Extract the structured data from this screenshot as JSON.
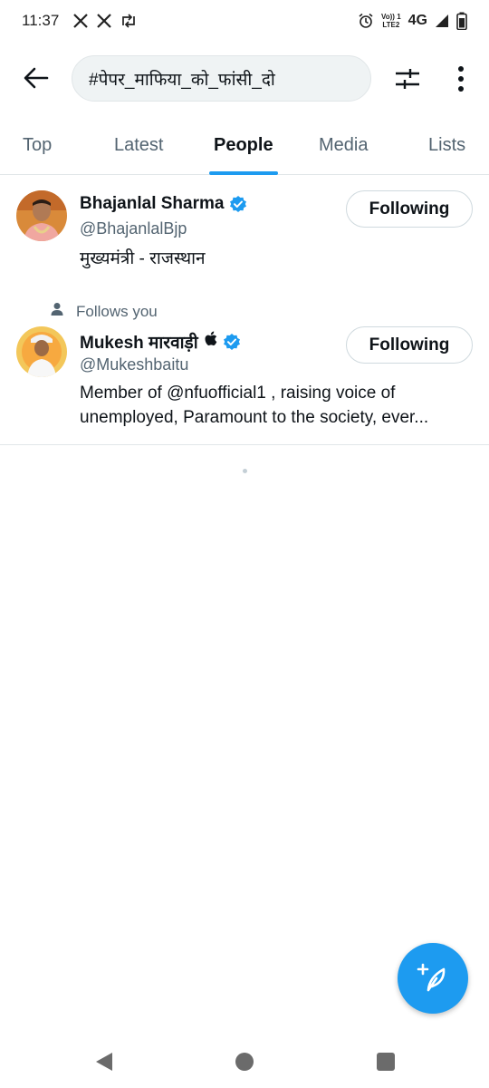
{
  "status_bar": {
    "time": "11:37",
    "volte_line1": "Vo)) 1",
    "volte_line2": "LTE2",
    "network": "4G",
    "notification_icons": [
      "x-logo-icon",
      "x-logo-icon",
      "repost-icon"
    ],
    "system_icons": [
      "alarm-icon",
      "signal-icon",
      "battery-icon"
    ]
  },
  "search": {
    "query": "#पेपर_माफिया_को_फांसी_दो"
  },
  "tabs": [
    {
      "label": "Top",
      "active": false
    },
    {
      "label": "Latest",
      "active": false
    },
    {
      "label": "People",
      "active": true
    },
    {
      "label": "Media",
      "active": false
    },
    {
      "label": "Lists",
      "active": false
    }
  ],
  "users": [
    {
      "name": "Bhajanlal Sharma",
      "handle": "@BhajanlalBjp",
      "bio": "मुख्यमंत्री - राजस्थान",
      "verified": true,
      "follow_label": "Following",
      "follows_you": ""
    },
    {
      "name": "Mukesh मारवाड़ी",
      "handle": "@Mukeshbaitu",
      "bio_line1": "Member of @nfuofficial1 , raising voice of",
      "bio_line2": "unemployed, Paramount to the society, ever...",
      "verified": true,
      "follow_label": "Following",
      "follows_you": "Follows you"
    }
  ],
  "colors": {
    "accent": "#1d9bf0",
    "text_primary": "#0f1419",
    "text_secondary": "#536471",
    "divider": "#e1e6e8"
  },
  "icons": {
    "back": "arrow-left-icon",
    "filter": "sliders-icon",
    "more": "vertical-dots-icon",
    "compose": "feather-plus-icon",
    "nav": [
      "back-triangle-icon",
      "home-circle-icon",
      "recents-square-icon"
    ]
  }
}
